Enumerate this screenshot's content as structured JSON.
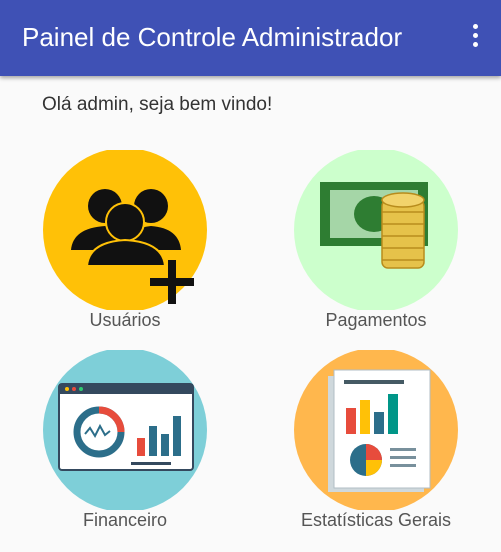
{
  "appbar": {
    "title": "Painel de Controle Administrador",
    "menu_icon": "more-vert-icon",
    "color": "#3f51b5"
  },
  "greeting": "Olá admin, seja bem vindo!",
  "tiles": [
    {
      "label": "Usuários",
      "icon": "users-add-icon",
      "bg": "#ffc107"
    },
    {
      "label": "Pagamentos",
      "icon": "money-coins-icon",
      "bg": "#ccffcc"
    },
    {
      "label": "Financeiro",
      "icon": "finance-dashboard-icon",
      "bg": "#7ecfd8"
    },
    {
      "label": "Estatísticas Gerais",
      "icon": "statistics-report-icon",
      "bg": "#ffb74d"
    }
  ]
}
